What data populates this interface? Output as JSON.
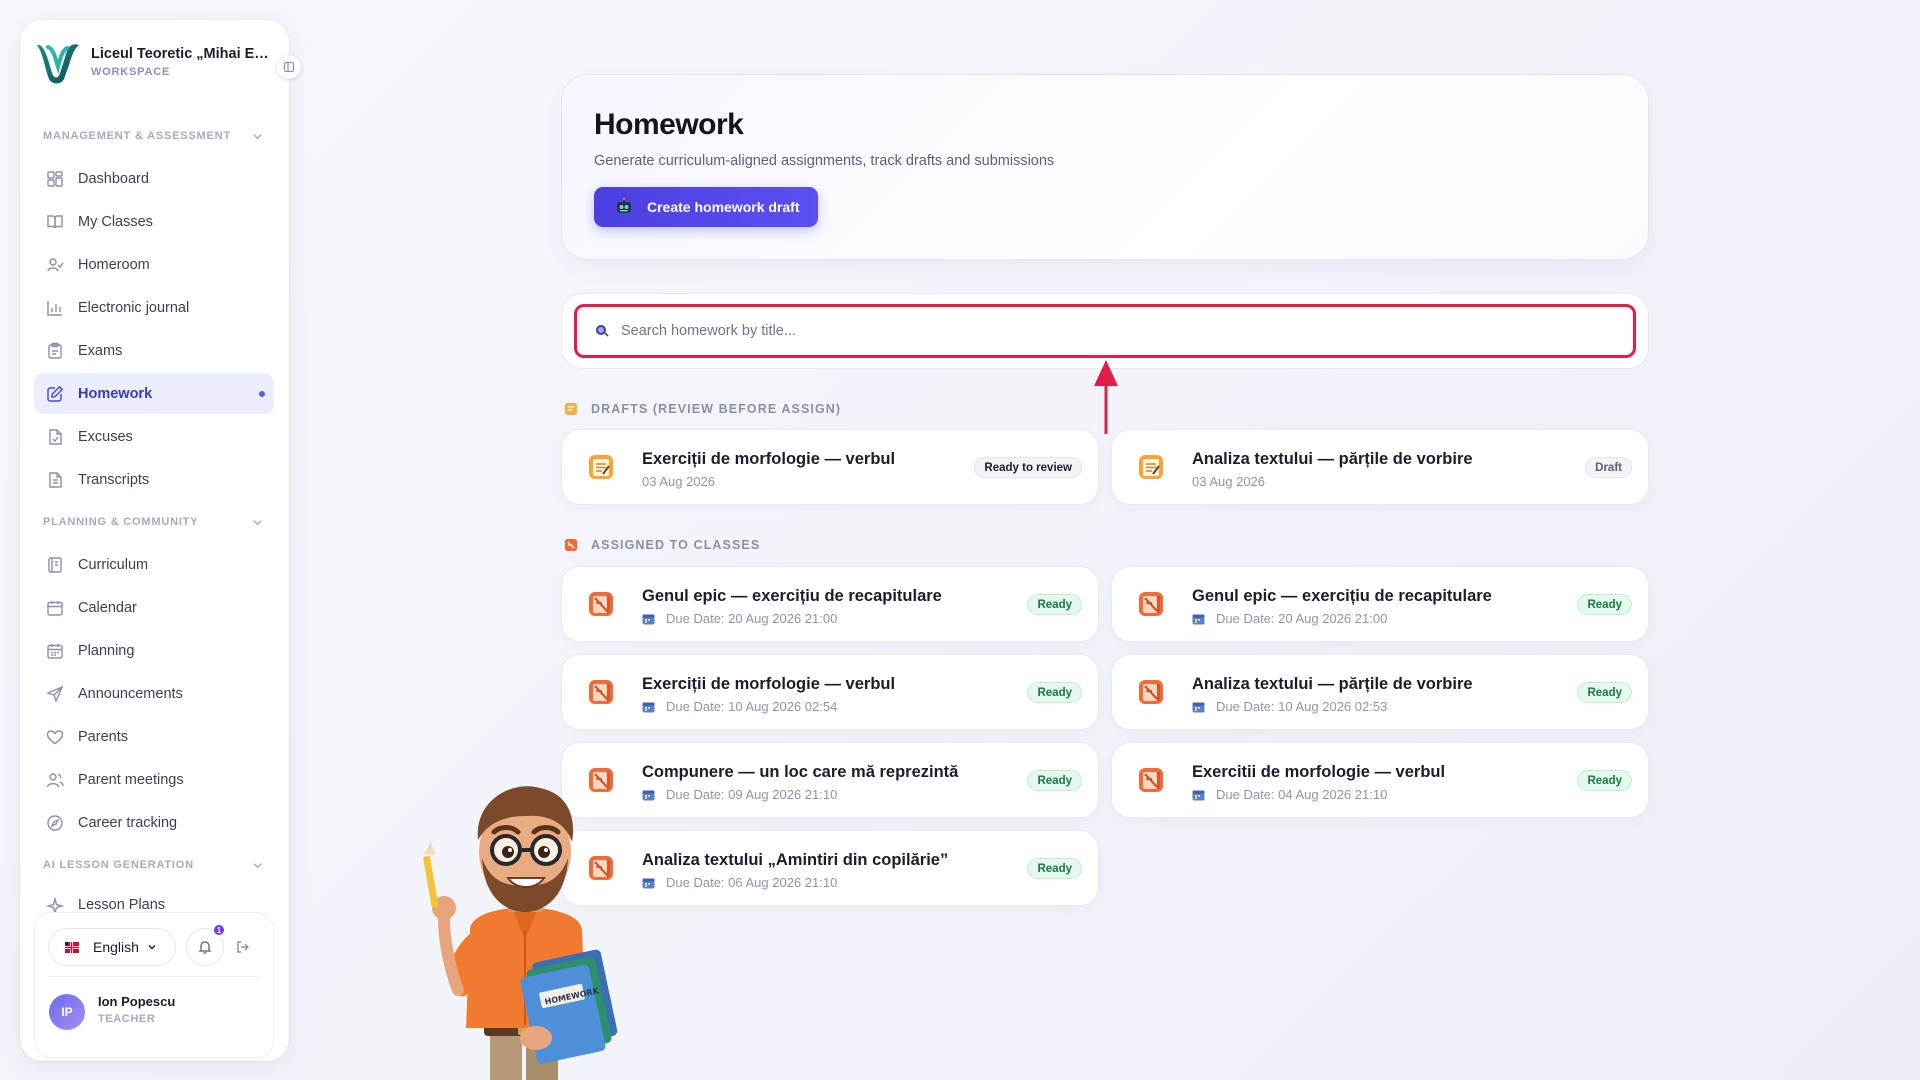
{
  "workspace": {
    "name": "Liceul Teoretic „Mihai Eminescu”",
    "label": "WORKSPACE"
  },
  "sidebar": {
    "sections": [
      {
        "title": "MANAGEMENT & ASSESSMENT",
        "items": [
          {
            "label": "Dashboard",
            "icon": "dashboard-icon"
          },
          {
            "label": "My Classes",
            "icon": "book-icon"
          },
          {
            "label": "Homeroom",
            "icon": "users-icon"
          },
          {
            "label": "Electronic journal",
            "icon": "bar-chart-icon"
          },
          {
            "label": "Exams",
            "icon": "clipboard-icon"
          },
          {
            "label": "Homework",
            "icon": "edit-icon",
            "active": true
          },
          {
            "label": "Excuses",
            "icon": "file-check-icon"
          },
          {
            "label": "Transcripts",
            "icon": "file-text-icon"
          }
        ]
      },
      {
        "title": "PLANNING & COMMUNITY",
        "items": [
          {
            "label": "Curriculum",
            "icon": "notebook-icon"
          },
          {
            "label": "Calendar",
            "icon": "calendar-icon"
          },
          {
            "label": "Planning",
            "icon": "calendar-grid-icon"
          },
          {
            "label": "Announcements",
            "icon": "send-icon"
          },
          {
            "label": "Parents",
            "icon": "heart-icon"
          },
          {
            "label": "Parent meetings",
            "icon": "people-icon"
          },
          {
            "label": "Career tracking",
            "icon": "compass-icon"
          }
        ]
      },
      {
        "title": "AI LESSON GENERATION",
        "items": [
          {
            "label": "Lesson Plans",
            "icon": "sparkle-icon"
          }
        ]
      }
    ]
  },
  "footer": {
    "language": "English",
    "notifications": "1",
    "user": {
      "initials": "IP",
      "name": "Ion Popescu",
      "role": "TEACHER"
    }
  },
  "hero": {
    "title": "Homework",
    "subtitle": "Generate curriculum-aligned assignments, track drafts and submissions",
    "button": "Create homework draft"
  },
  "search": {
    "placeholder": "Search homework by title...",
    "value": ""
  },
  "drafts": {
    "label": "DRAFTS (REVIEW BEFORE ASSIGN)",
    "items": [
      {
        "title": "Exerciții de morfologie — verbul",
        "date": "03 Aug 2026",
        "status": "Ready to review"
      },
      {
        "title": "Analiza textului — părțile de vorbire",
        "date": "03 Aug 2026",
        "status": "Draft"
      }
    ]
  },
  "assigned": {
    "label": "ASSIGNED TO CLASSES",
    "items": [
      {
        "title": "Genul epic — exercițiu de recapitulare",
        "due": "Due Date: 20 Aug 2026 21:00",
        "status": "Ready"
      },
      {
        "title": "Genul epic — exercițiu de recapitulare",
        "due": "Due Date: 20 Aug 2026 21:00",
        "status": "Ready"
      },
      {
        "title": "Exerciții de morfologie — verbul",
        "due": "Due Date: 10 Aug 2026 02:54",
        "status": "Ready"
      },
      {
        "title": "Analiza textului — părțile de vorbire",
        "due": "Due Date: 10 Aug 2026 02:53",
        "status": "Ready"
      },
      {
        "title": "Compunere — un loc care mă reprezintă",
        "due": "Due Date: 09 Aug 2026 21:10",
        "status": "Ready"
      },
      {
        "title": "Exercitii de morfologie — verbul",
        "due": "Due Date: 04 Aug 2026 21:10",
        "status": "Ready"
      },
      {
        "title": "Analiza textului „Amintiri din copilărie”",
        "due": "Due Date: 06 Aug 2026 21:10",
        "status": "Ready"
      }
    ]
  },
  "mascot": {
    "book_label": "HOMEWORK"
  },
  "colors": {
    "accent": "#4b3fe0",
    "highlight": "#e11d48",
    "ready": "#167a45"
  }
}
